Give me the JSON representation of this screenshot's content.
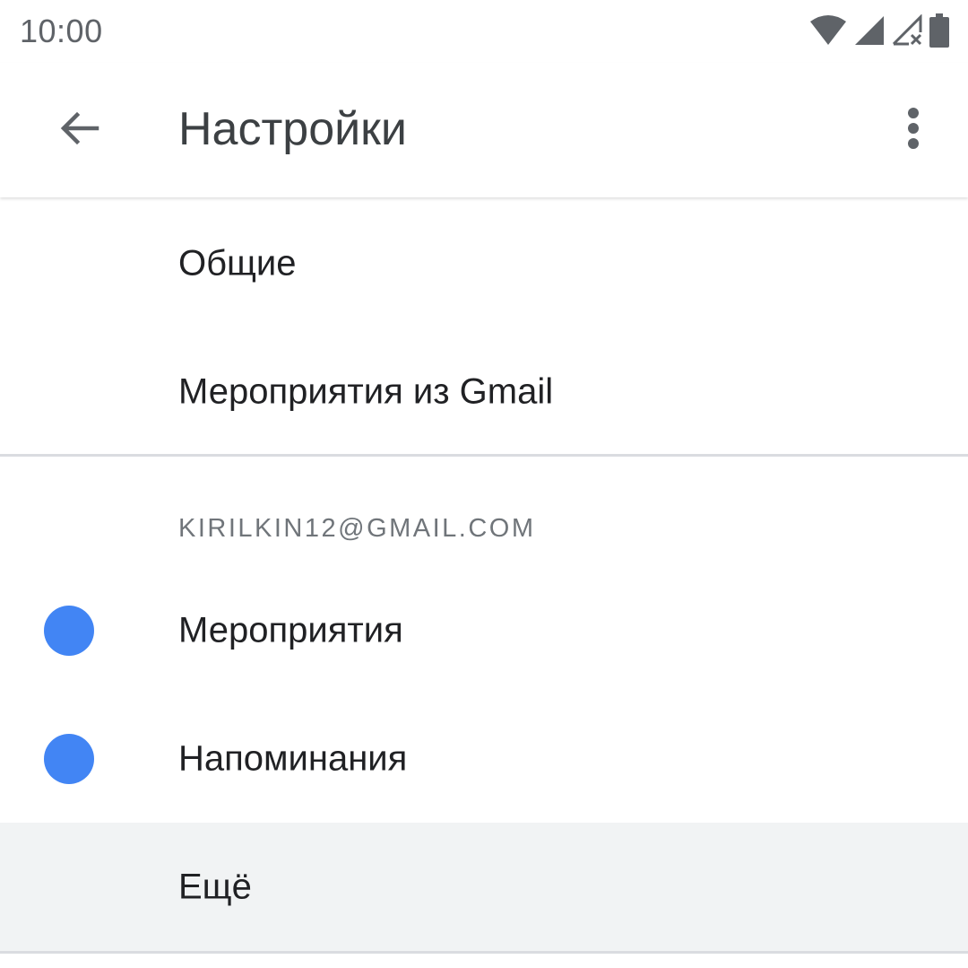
{
  "status_bar": {
    "time": "10:00",
    "icons": [
      "wifi-icon",
      "cell-signal-icon",
      "cell-signal-no-data-icon",
      "battery-icon"
    ]
  },
  "app_bar": {
    "title": "Настройки",
    "back_icon": "arrow-back-icon",
    "overflow_icon": "more-vert-icon"
  },
  "general_items": [
    {
      "label": "Общие"
    },
    {
      "label": "Мероприятия из Gmail"
    }
  ],
  "account": {
    "email": "KIRILKIN12@GMAIL.COM",
    "calendars": [
      {
        "label": "Мероприятия",
        "color": "#4285f4"
      },
      {
        "label": "Напоминания",
        "color": "#4285f4"
      }
    ],
    "more_label": "Ещё"
  },
  "colors": {
    "accent": "#4285f4",
    "highlight": "#f1f3f4",
    "divider": "#dadce0"
  }
}
